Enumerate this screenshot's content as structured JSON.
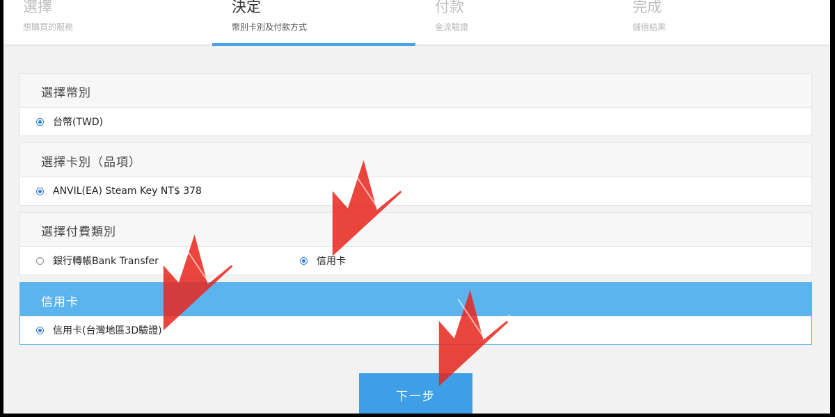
{
  "steps": [
    {
      "title": "選擇",
      "subtitle": "想購買的服務"
    },
    {
      "title": "決定",
      "subtitle": "幣別卡別及付款方式"
    },
    {
      "title": "付款",
      "subtitle": "金流驗證"
    },
    {
      "title": "完成",
      "subtitle": "儲值結果"
    }
  ],
  "active_step": 1,
  "panels": {
    "currency": {
      "header": "選擇幣別",
      "options": [
        {
          "label": "台幣(TWD)",
          "checked": true
        }
      ]
    },
    "card_type": {
      "header": "選擇卡別（品項）",
      "options": [
        {
          "label": "ANVIL(EA) Steam Key NT$ 378",
          "checked": true
        }
      ]
    },
    "payment_type": {
      "header": "選擇付費類別",
      "options": [
        {
          "label": "銀行轉帳Bank Transfer",
          "checked": false
        },
        {
          "label": "信用卡",
          "checked": true
        }
      ]
    },
    "credit_card": {
      "header": "信用卡",
      "options": [
        {
          "label": "信用卡(台灣地區3D驗證)",
          "checked": true
        }
      ]
    }
  },
  "next_button": "下一步",
  "colors": {
    "accent": "#4aa3e3",
    "button": "#3e9fe6",
    "annotation": "#e8261d"
  }
}
